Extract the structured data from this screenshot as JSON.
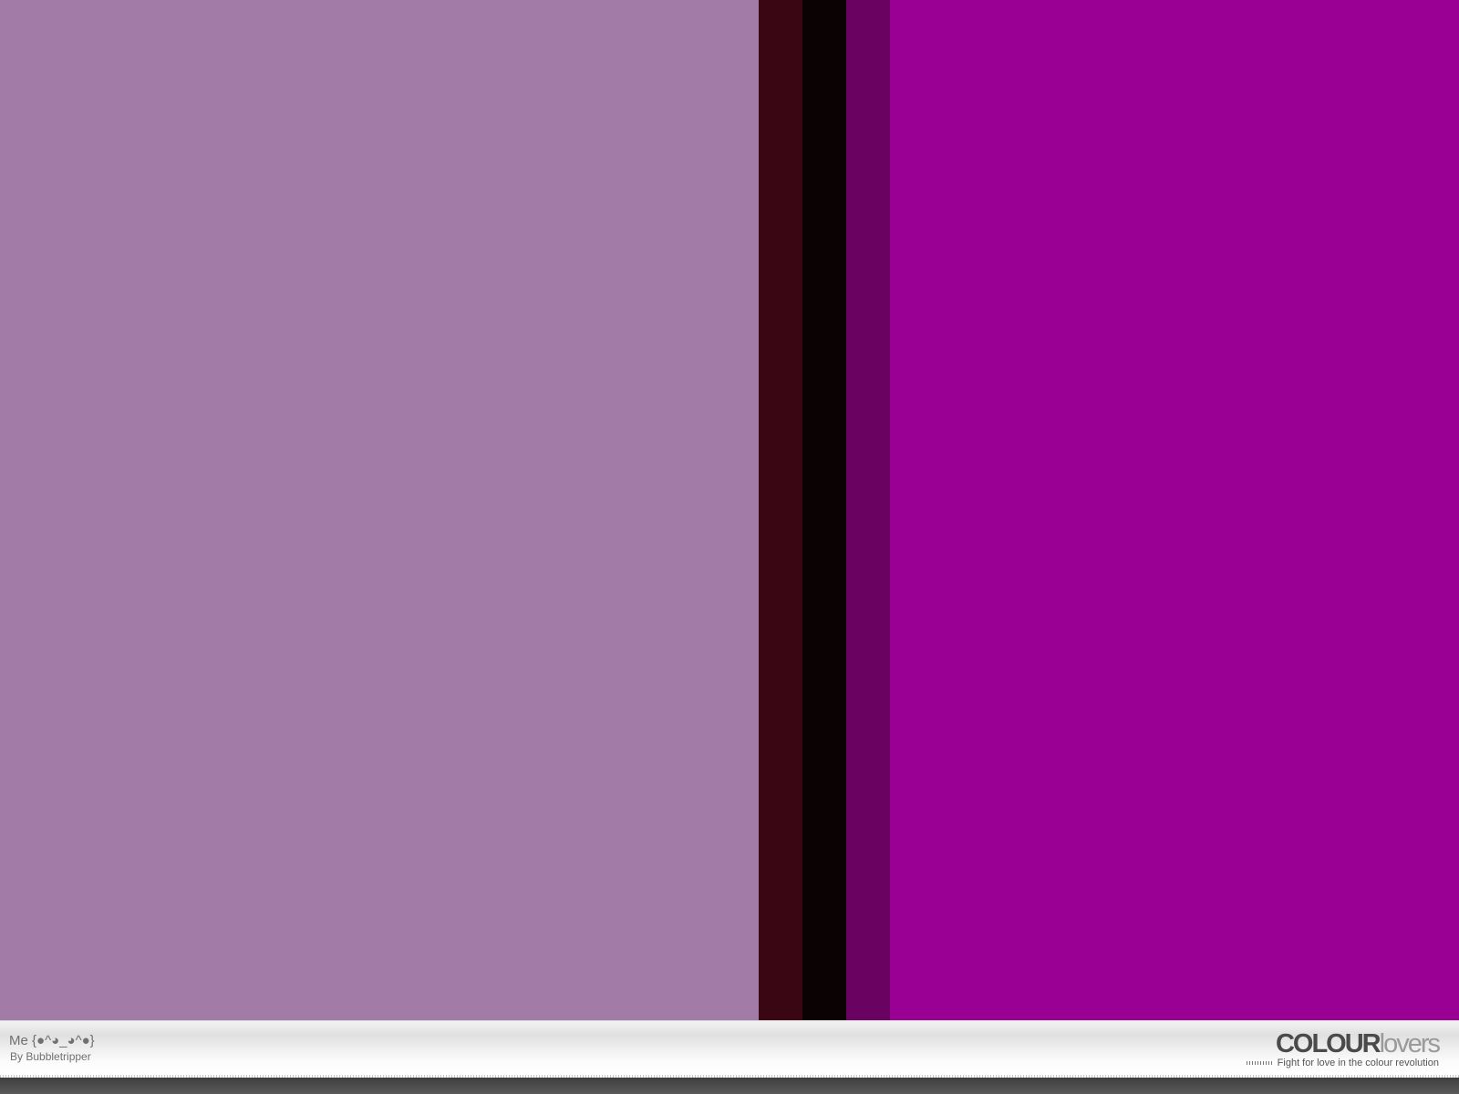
{
  "palette": {
    "title": "Me {●^◕_◕^●}",
    "author": "By Bubbletripper",
    "swatches": [
      {
        "color": "#A37BA7",
        "weight": 0.52
      },
      {
        "color": "#3A0614",
        "weight": 0.03
      },
      {
        "color": "#0B0303",
        "weight": 0.03
      },
      {
        "color": "#690260",
        "weight": 0.03
      },
      {
        "color": "#990093",
        "weight": 0.39
      }
    ]
  },
  "branding": {
    "logo_bold": "COLOUR",
    "logo_light": "lovers",
    "tagline": "Fight for love in the colour revolution"
  }
}
